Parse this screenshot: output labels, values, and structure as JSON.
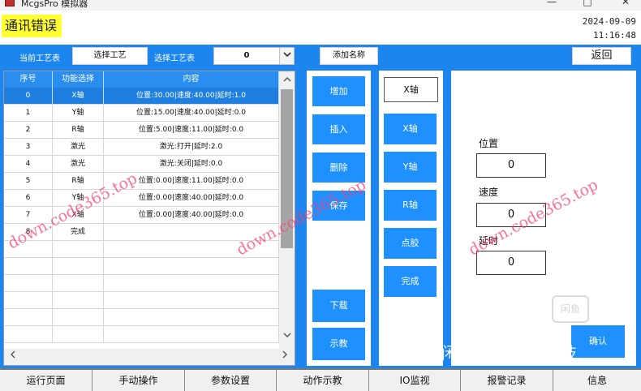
{
  "window": {
    "title": "McgsPro 模拟器",
    "minimize": "—",
    "maximize": "□",
    "close": "✕"
  },
  "header": {
    "error_banner": "通讯错误",
    "date": "2024-09-09",
    "time": "11:16:48"
  },
  "toolbar": {
    "current_table_label": "当前工艺表",
    "current_table_value": "选择工艺",
    "select_table_label": "选择工艺表",
    "select_table_value": "0",
    "add_name": "添加名称",
    "back": "返回"
  },
  "table": {
    "columns": [
      "序号",
      "功能选择",
      "内容"
    ],
    "selected_row": 0,
    "rows": [
      {
        "no": "0",
        "func": "X轴",
        "content": "位置:30.00|速度:40.00|延时:1.0"
      },
      {
        "no": "1",
        "func": "Y轴",
        "content": "位置:15.00|速度:40.00|延时:0.0"
      },
      {
        "no": "2",
        "func": "R轴",
        "content": "位置:5.00|速度:11.00|延时:0.0"
      },
      {
        "no": "3",
        "func": "激光",
        "content": "激光:打开|延时:2.0"
      },
      {
        "no": "4",
        "func": "激光",
        "content": "激光:关闭|延时:0.0"
      },
      {
        "no": "5",
        "func": "R轴",
        "content": "位置:0.00|速度:11.00|延时:0.0"
      },
      {
        "no": "6",
        "func": "Y轴",
        "content": "位置:0.00|速度:40.00|延时:0.0"
      },
      {
        "no": "7",
        "func": "X轴",
        "content": "位置:0.00|速度:40.00|延时:0.0"
      },
      {
        "no": "8",
        "func": "完成",
        "content": ""
      }
    ]
  },
  "actions": {
    "add": "增加",
    "insert": "插入",
    "delete": "删除",
    "save": "保存",
    "download": "下载",
    "teach": "示教"
  },
  "axis": {
    "current": "X轴",
    "x": "X轴",
    "y": "Y轴",
    "r": "R轴",
    "glue": "点胶",
    "done": "完成"
  },
  "params": {
    "position_label": "位置",
    "position_value": "0",
    "speed_label": "速度",
    "speed_value": "0",
    "delay_label": "延时",
    "delay_value": "0",
    "confirm": "确认"
  },
  "nav": [
    "运行页面",
    "手动操作",
    "参数设置",
    "动作示教",
    "IO监视",
    "报警记录",
    "信息"
  ],
  "watermark": {
    "site": "down.code365.top",
    "seal": "闲鱼",
    "footer": "闲鱼号：汇玩科技"
  },
  "colors": {
    "accent": "#1c86ee",
    "button": "#1e90ff",
    "selected_row": "#1e7fe0",
    "banner": "#ffff33",
    "watermark": "#ff3b6e"
  }
}
